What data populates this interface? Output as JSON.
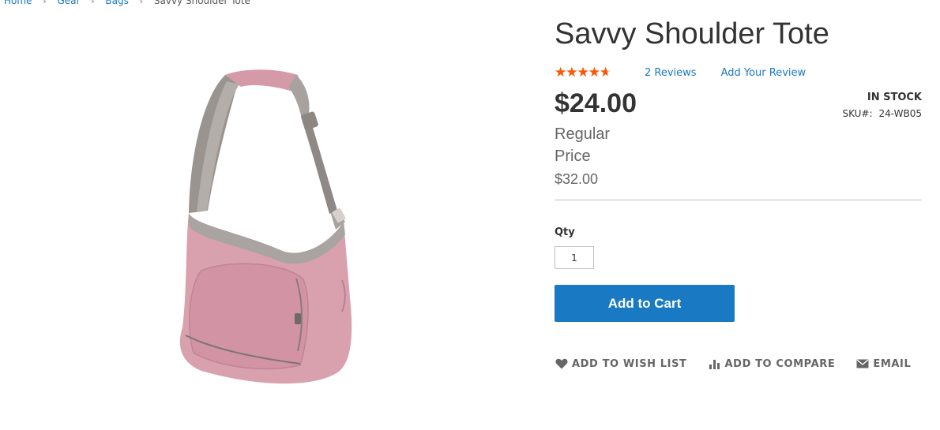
{
  "breadcrumb": {
    "items": [
      "Home",
      "Gear",
      "Bags"
    ],
    "current": "Savvy Shoulder Tote"
  },
  "product": {
    "name": "Savvy Shoulder Tote",
    "rating_percent": 80,
    "reviews_label": "2  Reviews",
    "add_review_label": "Add Your Review",
    "price": "$24.00",
    "regular_price_label": "Regular Price",
    "regular_price": "$32.00",
    "stock": "IN STOCK",
    "sku_label": "SKU#:",
    "sku": "24-WB05"
  },
  "form": {
    "qty_label": "Qty",
    "qty_value": "1",
    "add_to_cart_label": "Add to Cart"
  },
  "actions": {
    "wishlist": "ADD TO WISH LIST",
    "compare": "ADD TO COMPARE",
    "email": "EMAIL"
  },
  "colors": {
    "accent": "#1979c3",
    "star": "#ff5501",
    "bag": "#d9a0ae"
  },
  "icons": {
    "rating": "star-icon",
    "wishlist": "heart-icon",
    "compare": "bar-chart-icon",
    "email": "envelope-icon"
  }
}
